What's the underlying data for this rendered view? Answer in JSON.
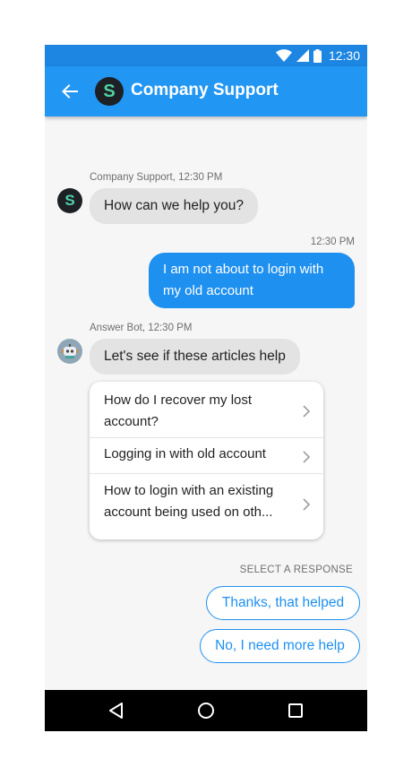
{
  "status_bar": {
    "time": "12:30"
  },
  "app_bar": {
    "avatar_letter": "S",
    "title": "Company Support"
  },
  "messages": {
    "support_sender": "Company Support, 12:30 PM",
    "support_avatar_letter": "S",
    "support_text": "How can we help you?",
    "user_time": "12:30 PM",
    "user_text": "I am not about to login with my old account",
    "bot_sender": "Answer Bot, 12:30 PM",
    "bot_text": "Let's see if these articles help"
  },
  "articles": [
    {
      "title": "How do I recover my lost account?"
    },
    {
      "title": "Logging in with old account"
    },
    {
      "title": "How to login with an existing account being used on oth..."
    }
  ],
  "responses": {
    "label": "SELECT A RESPONSE",
    "options": [
      "Thanks, that helped",
      "No, I need more help"
    ]
  },
  "colors": {
    "accent": "#2196f3",
    "status_bar": "#1c86e2",
    "user_bubble": "#1e90f0",
    "avatar_bg": "#1d2024",
    "avatar_letter": "#4fd1a5"
  },
  "icons": [
    "wifi-icon",
    "signal-icon",
    "battery-icon",
    "back-arrow-icon",
    "chevron-right-icon",
    "robot-icon",
    "nav-back-icon",
    "nav-home-icon",
    "nav-recents-icon"
  ]
}
